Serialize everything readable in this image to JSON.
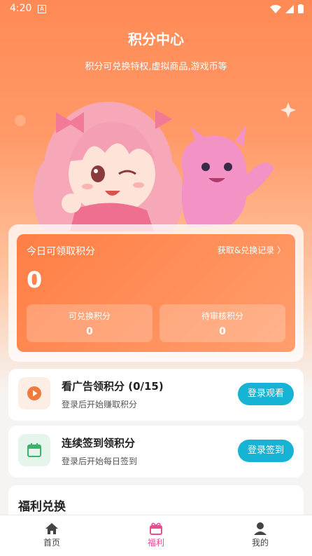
{
  "status_bar": {
    "time": "4:20",
    "notif": "A"
  },
  "header": {
    "title": "积分中心",
    "subtitle": "积分可兑换特权,虚拟商品,游戏币等"
  },
  "points": {
    "today_label": "今日可领取积分",
    "record_link": "获取&兑换记录 〉",
    "today_value": "0",
    "exchangeable_label": "可兑换积分",
    "exchangeable_value": "0",
    "pending_label": "待审核积分",
    "pending_value": "0"
  },
  "tasks": [
    {
      "title": "看广告领积分 (0/15)",
      "desc": "登录后开始赚取积分",
      "button": "登录观看",
      "icon": "play-icon"
    },
    {
      "title": "连续签到领积分",
      "desc": "登录后开始每日签到",
      "button": "登录签到",
      "icon": "calendar-icon"
    }
  ],
  "welfare": {
    "title": "福利兑换"
  },
  "nav": [
    {
      "label": "首页",
      "icon": "home-icon"
    },
    {
      "label": "福利",
      "icon": "gift-icon"
    },
    {
      "label": "我的",
      "icon": "user-icon"
    }
  ],
  "colors": {
    "accent_orange": "#ff8a55",
    "button_cyan": "#17b3d4",
    "nav_active": "#e64d93"
  }
}
